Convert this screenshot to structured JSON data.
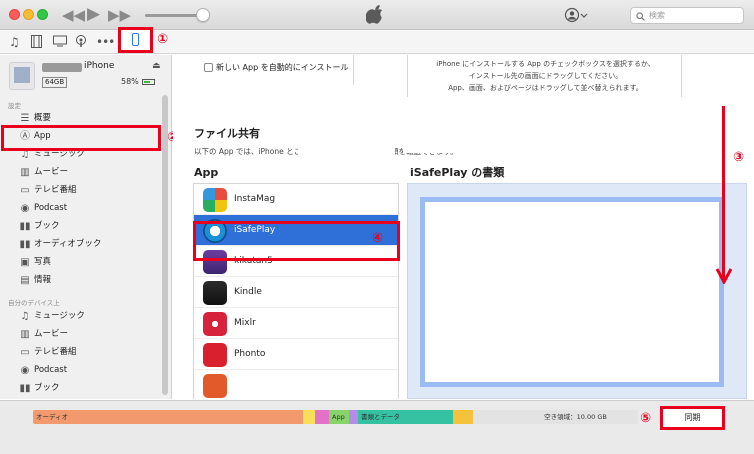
{
  "titlebar": {
    "search_placeholder": "検索",
    "icons": [
      "rewind-icon",
      "play-icon",
      "fast-forward-icon",
      "apple-logo",
      "account-icon",
      "search-icon"
    ],
    "volume_level": 0.85
  },
  "toolbar": {
    "icons": [
      "music-icon",
      "movie-icon",
      "tv-icon",
      "podcast-icon",
      "more-icon",
      "iphone-device-icon"
    ]
  },
  "annotations": {
    "n1": "①",
    "n2": "②",
    "n3": "③",
    "n4": "④",
    "n5": "⑤"
  },
  "device": {
    "name": "iPhone",
    "capacity": "64GB",
    "battery": "58%"
  },
  "sidebar": {
    "settings_header": "設定",
    "settings_items": [
      {
        "label": "概要",
        "icon": "summary-icon"
      },
      {
        "label": "App",
        "icon": "app-store-icon"
      },
      {
        "label": "ミュージック",
        "icon": "music-icon"
      },
      {
        "label": "ムービー",
        "icon": "movie-icon"
      },
      {
        "label": "テレビ番組",
        "icon": "tv-icon"
      },
      {
        "label": "Podcast",
        "icon": "podcast-icon"
      },
      {
        "label": "ブック",
        "icon": "book-icon"
      },
      {
        "label": "オーディオブック",
        "icon": "audiobook-icon"
      },
      {
        "label": "写真",
        "icon": "photo-icon"
      },
      {
        "label": "情報",
        "icon": "info-icon"
      }
    ],
    "ondevice_header": "自分のデバイス上",
    "ondevice_items": [
      {
        "label": "ミュージック",
        "icon": "music-icon"
      },
      {
        "label": "ムービー",
        "icon": "movie-icon"
      },
      {
        "label": "テレビ番組",
        "icon": "tv-icon"
      },
      {
        "label": "Podcast",
        "icon": "podcast-icon"
      },
      {
        "label": "ブック",
        "icon": "book-icon"
      }
    ]
  },
  "main": {
    "auto_install_label": "新しい App を自動的にインストール",
    "install_info": [
      "iPhone にインストールする App のチェックボックスを選択するか、",
      "インストール先の画面にドラッグしてください。",
      "App、画面、およびページはドラッグして並べ替えられます。"
    ],
    "file_sharing_title": "ファイル共有",
    "file_sharing_desc": "以下の App では、iPhone とこのコンピュータとの間で書類を転送できます。",
    "apps_header": "App",
    "docs_header": "iSafePlay の書類",
    "apps": [
      {
        "name": "InstaMag",
        "icon": "instamag-icon",
        "selected": false
      },
      {
        "name": "iSafePlay",
        "icon": "isafeplay-icon",
        "selected": true
      },
      {
        "name": "kikutan5",
        "icon": "kikutan-icon",
        "selected": false
      },
      {
        "name": "Kindle",
        "icon": "kindle-icon",
        "selected": false
      },
      {
        "name": "Mixlr",
        "icon": "mixlr-icon",
        "selected": false
      },
      {
        "name": "Phonto",
        "icon": "phonto-icon",
        "selected": false
      }
    ]
  },
  "storage": {
    "segments": [
      {
        "label": "オーディオ",
        "color": "#f29a6e"
      },
      {
        "label": "",
        "color": "#f6e05a"
      },
      {
        "label": "",
        "color": "#e471c8"
      },
      {
        "label": "App",
        "color": "#86d46a"
      },
      {
        "label": "",
        "color": "#b48be6"
      },
      {
        "label": "書類とデータ",
        "color": "#35c2a3"
      },
      {
        "label": "",
        "color": "#f5c33b"
      }
    ],
    "free_label": "空き領域：10.00 GB",
    "sync_label": "同期"
  },
  "colors": {
    "annotation_red": "#e8001c",
    "selection_blue": "#2f6fd8"
  }
}
